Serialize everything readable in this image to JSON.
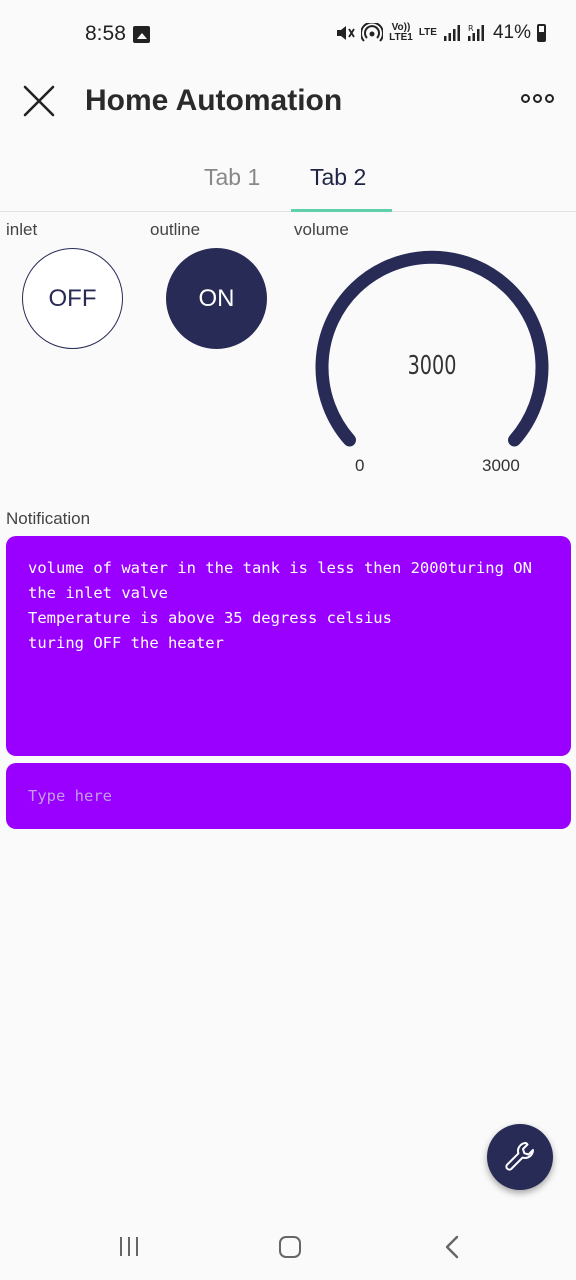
{
  "status_bar": {
    "time": "8:58",
    "battery": "41%",
    "icons": [
      "photo-icon",
      "mute-icon",
      "hotspot-icon",
      "volte-icon",
      "lte-icon",
      "signal-icon",
      "signal-roaming-icon",
      "battery-icon"
    ],
    "volte_label": "Vo))\nLTE1",
    "lte_label": "LTE"
  },
  "header": {
    "title": "Home Automation",
    "close_icon": "close-icon",
    "more_icon": "more-icon"
  },
  "tabs": [
    {
      "label": "Tab 1",
      "active": false
    },
    {
      "label": "Tab 2",
      "active": true
    }
  ],
  "widgets": {
    "inlet": {
      "label": "inlet",
      "state": "OFF"
    },
    "outline": {
      "label": "outline",
      "state": "ON"
    },
    "volume": {
      "label": "volume",
      "value": "3000",
      "min": "0",
      "max": "3000",
      "level": 1.0
    }
  },
  "notification": {
    "label": "Notification",
    "text": "volume of water in the tank is less then 2000turing ON\nthe inlet valve\nTemperature is above 35 degress celsius\nturing OFF the heater",
    "input_placeholder": "Type here"
  },
  "colors": {
    "primary": "#272b55",
    "accent": "#5fd0a8",
    "terminal": "#9900ff"
  },
  "fab": {
    "icon": "wrench-icon"
  },
  "nav_bar": {
    "icons": [
      "recent-apps-icon",
      "home-icon",
      "back-icon"
    ]
  }
}
